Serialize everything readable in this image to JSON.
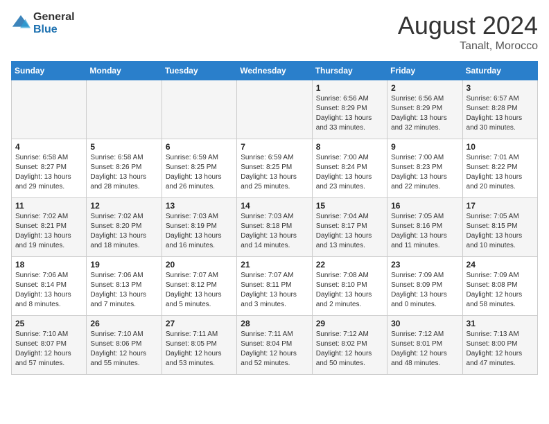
{
  "header": {
    "logo_general": "General",
    "logo_blue": "Blue",
    "month_year": "August 2024",
    "location": "Tanalt, Morocco"
  },
  "weekdays": [
    "Sunday",
    "Monday",
    "Tuesday",
    "Wednesday",
    "Thursday",
    "Friday",
    "Saturday"
  ],
  "weeks": [
    [
      {
        "day": "",
        "info": ""
      },
      {
        "day": "",
        "info": ""
      },
      {
        "day": "",
        "info": ""
      },
      {
        "day": "",
        "info": ""
      },
      {
        "day": "1",
        "info": "Sunrise: 6:56 AM\nSunset: 8:29 PM\nDaylight: 13 hours\nand 33 minutes."
      },
      {
        "day": "2",
        "info": "Sunrise: 6:56 AM\nSunset: 8:29 PM\nDaylight: 13 hours\nand 32 minutes."
      },
      {
        "day": "3",
        "info": "Sunrise: 6:57 AM\nSunset: 8:28 PM\nDaylight: 13 hours\nand 30 minutes."
      }
    ],
    [
      {
        "day": "4",
        "info": "Sunrise: 6:58 AM\nSunset: 8:27 PM\nDaylight: 13 hours\nand 29 minutes."
      },
      {
        "day": "5",
        "info": "Sunrise: 6:58 AM\nSunset: 8:26 PM\nDaylight: 13 hours\nand 28 minutes."
      },
      {
        "day": "6",
        "info": "Sunrise: 6:59 AM\nSunset: 8:25 PM\nDaylight: 13 hours\nand 26 minutes."
      },
      {
        "day": "7",
        "info": "Sunrise: 6:59 AM\nSunset: 8:25 PM\nDaylight: 13 hours\nand 25 minutes."
      },
      {
        "day": "8",
        "info": "Sunrise: 7:00 AM\nSunset: 8:24 PM\nDaylight: 13 hours\nand 23 minutes."
      },
      {
        "day": "9",
        "info": "Sunrise: 7:00 AM\nSunset: 8:23 PM\nDaylight: 13 hours\nand 22 minutes."
      },
      {
        "day": "10",
        "info": "Sunrise: 7:01 AM\nSunset: 8:22 PM\nDaylight: 13 hours\nand 20 minutes."
      }
    ],
    [
      {
        "day": "11",
        "info": "Sunrise: 7:02 AM\nSunset: 8:21 PM\nDaylight: 13 hours\nand 19 minutes."
      },
      {
        "day": "12",
        "info": "Sunrise: 7:02 AM\nSunset: 8:20 PM\nDaylight: 13 hours\nand 18 minutes."
      },
      {
        "day": "13",
        "info": "Sunrise: 7:03 AM\nSunset: 8:19 PM\nDaylight: 13 hours\nand 16 minutes."
      },
      {
        "day": "14",
        "info": "Sunrise: 7:03 AM\nSunset: 8:18 PM\nDaylight: 13 hours\nand 14 minutes."
      },
      {
        "day": "15",
        "info": "Sunrise: 7:04 AM\nSunset: 8:17 PM\nDaylight: 13 hours\nand 13 minutes."
      },
      {
        "day": "16",
        "info": "Sunrise: 7:05 AM\nSunset: 8:16 PM\nDaylight: 13 hours\nand 11 minutes."
      },
      {
        "day": "17",
        "info": "Sunrise: 7:05 AM\nSunset: 8:15 PM\nDaylight: 13 hours\nand 10 minutes."
      }
    ],
    [
      {
        "day": "18",
        "info": "Sunrise: 7:06 AM\nSunset: 8:14 PM\nDaylight: 13 hours\nand 8 minutes."
      },
      {
        "day": "19",
        "info": "Sunrise: 7:06 AM\nSunset: 8:13 PM\nDaylight: 13 hours\nand 7 minutes."
      },
      {
        "day": "20",
        "info": "Sunrise: 7:07 AM\nSunset: 8:12 PM\nDaylight: 13 hours\nand 5 minutes."
      },
      {
        "day": "21",
        "info": "Sunrise: 7:07 AM\nSunset: 8:11 PM\nDaylight: 13 hours\nand 3 minutes."
      },
      {
        "day": "22",
        "info": "Sunrise: 7:08 AM\nSunset: 8:10 PM\nDaylight: 13 hours\nand 2 minutes."
      },
      {
        "day": "23",
        "info": "Sunrise: 7:09 AM\nSunset: 8:09 PM\nDaylight: 13 hours\nand 0 minutes."
      },
      {
        "day": "24",
        "info": "Sunrise: 7:09 AM\nSunset: 8:08 PM\nDaylight: 12 hours\nand 58 minutes."
      }
    ],
    [
      {
        "day": "25",
        "info": "Sunrise: 7:10 AM\nSunset: 8:07 PM\nDaylight: 12 hours\nand 57 minutes."
      },
      {
        "day": "26",
        "info": "Sunrise: 7:10 AM\nSunset: 8:06 PM\nDaylight: 12 hours\nand 55 minutes."
      },
      {
        "day": "27",
        "info": "Sunrise: 7:11 AM\nSunset: 8:05 PM\nDaylight: 12 hours\nand 53 minutes."
      },
      {
        "day": "28",
        "info": "Sunrise: 7:11 AM\nSunset: 8:04 PM\nDaylight: 12 hours\nand 52 minutes."
      },
      {
        "day": "29",
        "info": "Sunrise: 7:12 AM\nSunset: 8:02 PM\nDaylight: 12 hours\nand 50 minutes."
      },
      {
        "day": "30",
        "info": "Sunrise: 7:12 AM\nSunset: 8:01 PM\nDaylight: 12 hours\nand 48 minutes."
      },
      {
        "day": "31",
        "info": "Sunrise: 7:13 AM\nSunset: 8:00 PM\nDaylight: 12 hours\nand 47 minutes."
      }
    ]
  ]
}
